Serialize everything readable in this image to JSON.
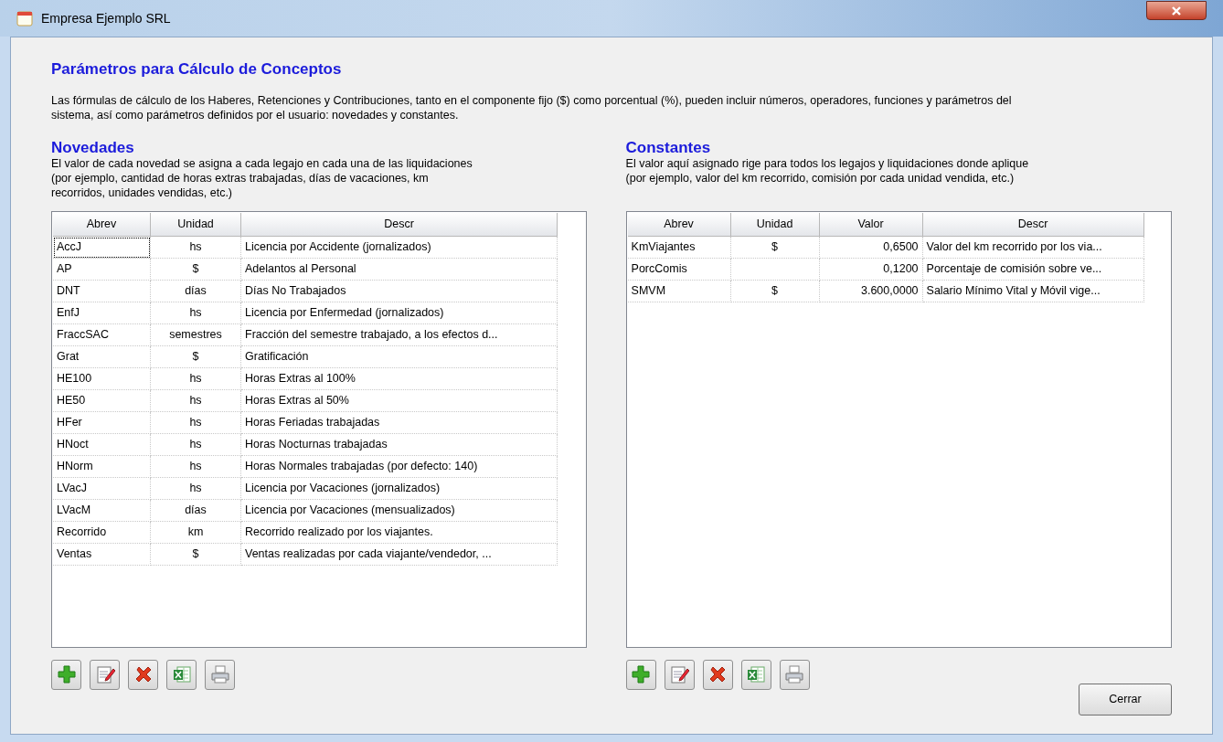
{
  "window": {
    "title": "Empresa Ejemplo SRL"
  },
  "heading": "Parámetros para Cálculo de Conceptos",
  "intro": "Las fórmulas de cálculo de los Haberes, Retenciones y Contribuciones, tanto en el componente fijo ($) como porcentual (%), pueden incluir números, operadores, funciones y parámetros del sistema, así como parámetros definidos por el usuario: novedades y constantes.",
  "novedades": {
    "title": "Novedades",
    "description": "El valor de cada novedad se asigna a cada legajo en cada una de las liquidaciones (por ejemplo, cantidad de horas extras trabajadas, días de vacaciones, km recorridos, unidades vendidas, etc.)",
    "columns": [
      "Abrev",
      "Unidad",
      "Descr"
    ],
    "rows": [
      {
        "abrev": "AccJ",
        "unidad": "hs",
        "descr": "Licencia por Accidente (jornalizados)",
        "focused": true
      },
      {
        "abrev": "AP",
        "unidad": "$",
        "descr": "Adelantos al Personal",
        "focused": false
      },
      {
        "abrev": "DNT",
        "unidad": "días",
        "descr": "Días No Trabajados",
        "focused": false
      },
      {
        "abrev": "EnfJ",
        "unidad": "hs",
        "descr": "Licencia por Enfermedad (jornalizados)",
        "focused": false
      },
      {
        "abrev": "FraccSAC",
        "unidad": "semestres",
        "descr": "Fracción del semestre trabajado, a los efectos d...",
        "focused": false
      },
      {
        "abrev": "Grat",
        "unidad": "$",
        "descr": "Gratificación",
        "focused": false
      },
      {
        "abrev": "HE100",
        "unidad": "hs",
        "descr": "Horas Extras al 100%",
        "focused": false
      },
      {
        "abrev": "HE50",
        "unidad": "hs",
        "descr": "Horas Extras al 50%",
        "focused": false
      },
      {
        "abrev": "HFer",
        "unidad": "hs",
        "descr": "Horas Feriadas trabajadas",
        "focused": false
      },
      {
        "abrev": "HNoct",
        "unidad": "hs",
        "descr": "Horas Nocturnas trabajadas",
        "focused": false
      },
      {
        "abrev": "HNorm",
        "unidad": "hs",
        "descr": "Horas Normales trabajadas (por defecto: 140)",
        "focused": false
      },
      {
        "abrev": "LVacJ",
        "unidad": "hs",
        "descr": "Licencia por Vacaciones (jornalizados)",
        "focused": false
      },
      {
        "abrev": "LVacM",
        "unidad": "días",
        "descr": "Licencia por Vacaciones (mensualizados)",
        "focused": false
      },
      {
        "abrev": "Recorrido",
        "unidad": "km",
        "descr": "Recorrido realizado por los viajantes.",
        "focused": false
      },
      {
        "abrev": "Ventas",
        "unidad": "$",
        "descr": "Ventas realizadas por cada viajante/vendedor, ...",
        "focused": false
      }
    ],
    "toolbar": [
      {
        "kind": "add"
      },
      {
        "kind": "edit"
      },
      {
        "kind": "delete"
      },
      {
        "kind": "excel"
      },
      {
        "kind": "print"
      }
    ]
  },
  "constantes": {
    "title": "Constantes",
    "description": "El valor aquí asignado rige para todos los legajos y liquidaciones donde aplique (por ejemplo, valor del km recorrido, comisión por cada unidad vendida, etc.)",
    "columns": [
      "Abrev",
      "Unidad",
      "Valor",
      "Descr"
    ],
    "rows": [
      {
        "abrev": "KmViajantes",
        "unidad": "$",
        "valor": "0,6500",
        "descr": "Valor del km recorrido por los via..."
      },
      {
        "abrev": "PorcComis",
        "valor": "0,1200",
        "descr": "Porcentaje de comisión sobre ve..."
      },
      {
        "abrev": "SMVM",
        "unidad": "$",
        "valor": "3.600,0000",
        "descr": "Salario Mínimo Vital y Móvil vige..."
      }
    ],
    "toolbar": [
      {
        "kind": "add"
      },
      {
        "kind": "edit"
      },
      {
        "kind": "delete"
      },
      {
        "kind": "excel"
      },
      {
        "kind": "print"
      }
    ]
  },
  "close_button": "Cerrar"
}
